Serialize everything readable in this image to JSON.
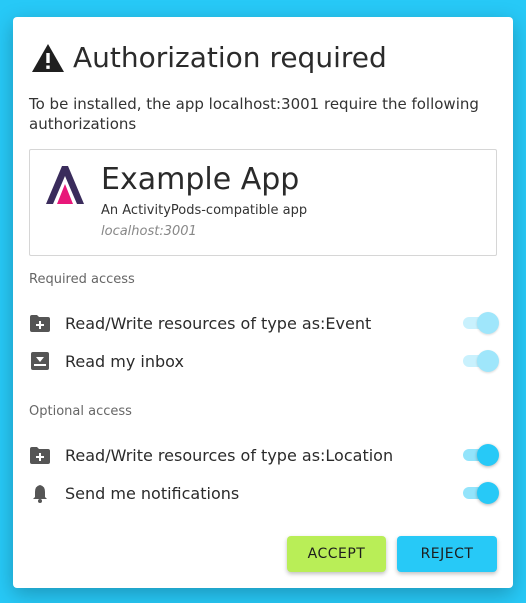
{
  "dialog": {
    "title": "Authorization required",
    "intro": "To be installed, the app localhost:3001 require the following authorizations"
  },
  "app": {
    "name": "Example App",
    "description": "An ActivityPods-compatible app",
    "domain": "localhost:3001",
    "logo_icon": "activitypods-logo"
  },
  "required_access": {
    "label": "Required access",
    "items": [
      {
        "label": "Read/Write resources of type as:Event",
        "icon": "folder-plus-icon",
        "checked": true,
        "disabled": true
      },
      {
        "label": "Read my inbox",
        "icon": "inbox-download-icon",
        "checked": true,
        "disabled": true
      }
    ]
  },
  "optional_access": {
    "label": "Optional access",
    "items": [
      {
        "label": "Read/Write resources of type as:Location",
        "icon": "folder-plus-icon",
        "checked": true,
        "disabled": false
      },
      {
        "label": "Send me notifications",
        "icon": "bell-icon",
        "checked": true,
        "disabled": false
      }
    ]
  },
  "actions": {
    "accept_label": "ACCEPT",
    "reject_label": "REJECT"
  },
  "colors": {
    "background": "#27c9f7",
    "accept": "#b9ee57",
    "reject": "#27c9f7",
    "toggle": "#27c9f7"
  }
}
